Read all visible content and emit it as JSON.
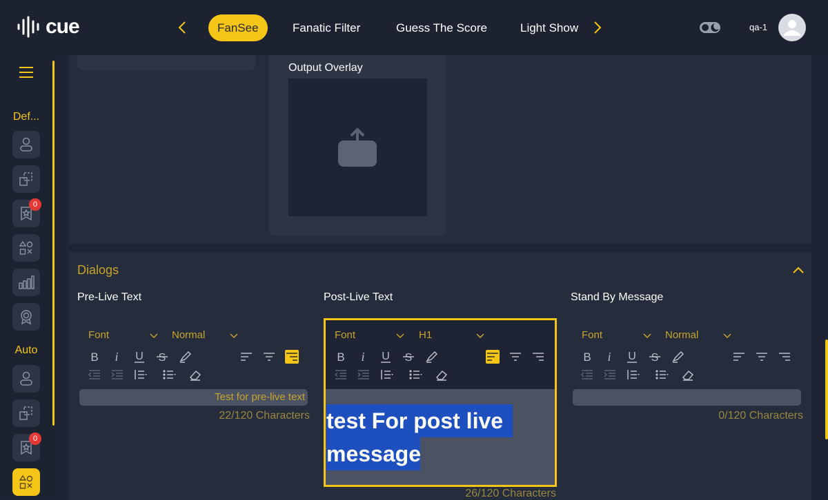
{
  "app": {
    "logo_text": "cue"
  },
  "nav": {
    "tabs": [
      {
        "label": "FanSee",
        "active": true
      },
      {
        "label": "Fanatic Filter"
      },
      {
        "label": "Guess The Score"
      },
      {
        "label": "Light Show"
      }
    ]
  },
  "user": {
    "name": "qa-1"
  },
  "sidebar": {
    "sections": [
      {
        "label": "Def..."
      },
      {
        "label": "Auto"
      }
    ],
    "badges": [
      "0",
      "0"
    ]
  },
  "overlay": {
    "label": "Output Overlay"
  },
  "dialogs": {
    "title": "Dialogs",
    "columns": [
      {
        "title": "Pre-Live Text",
        "font_label": "Font",
        "size_label": "Normal",
        "text": "Test for pre-live text",
        "char_count": "22/120 Characters"
      },
      {
        "title": "Post-Live Text",
        "font_label": "Font",
        "size_label": "H1",
        "text_line1": "test For post live",
        "text_line2": "message",
        "char_count": "26/120 Characters"
      },
      {
        "title": "Stand By Message",
        "font_label": "Font",
        "size_label": "Normal",
        "text": "",
        "char_count": "0/120 Characters"
      }
    ]
  },
  "colors": {
    "accent": "#f5c518",
    "bg": "#1e2433",
    "panel": "#252c3b",
    "selection": "#1e4fbf"
  }
}
